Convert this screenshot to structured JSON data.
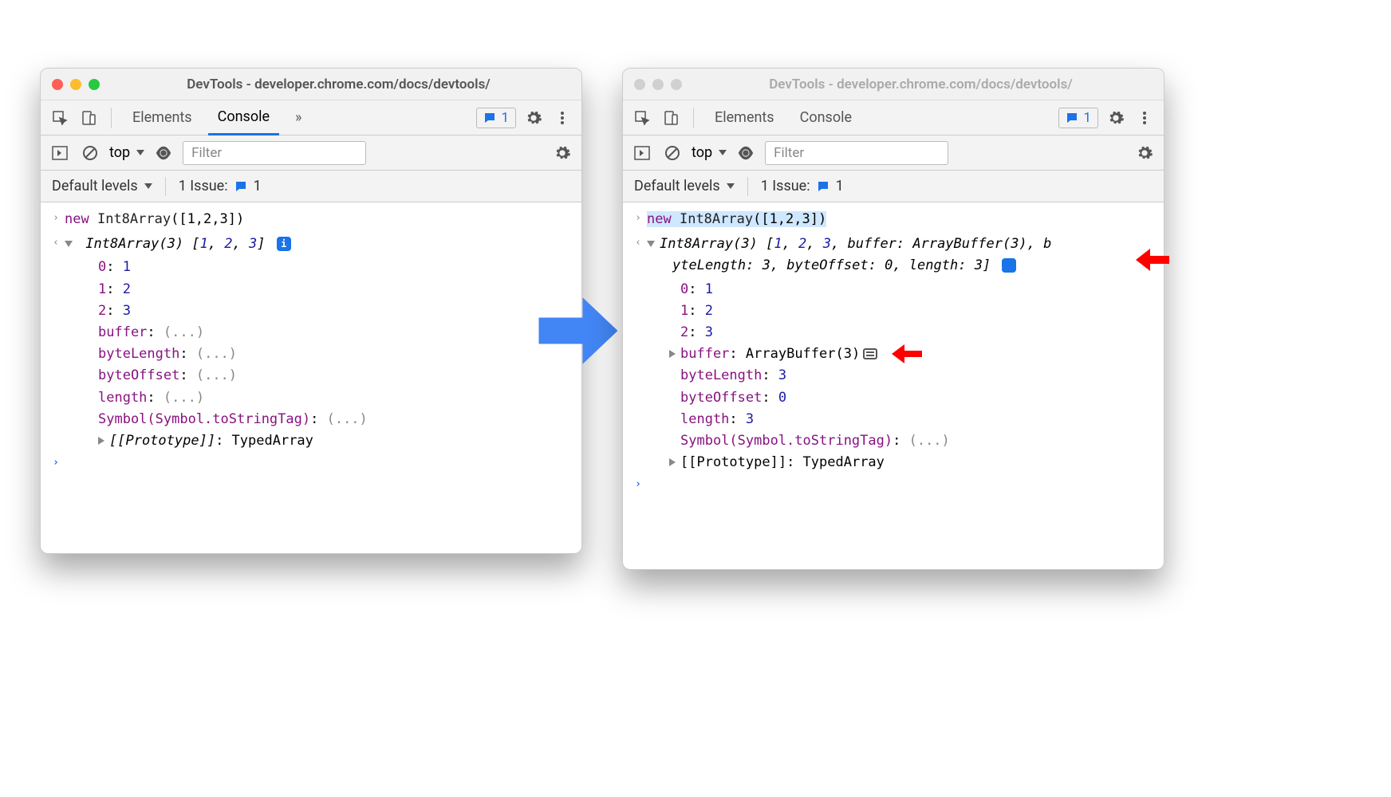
{
  "windowTitle": "DevTools - developer.chrome.com/docs/devtools/",
  "tabs": {
    "elements": "Elements",
    "console": "Console",
    "more": "»"
  },
  "messagesBadge": "1",
  "toolbar": {
    "context": "top",
    "filterPlaceholder": "Filter"
  },
  "toolbar2": {
    "levels": "Default levels",
    "issueLabel": "1 Issue:",
    "issueCount": "1"
  },
  "input": {
    "new": "new",
    "fn": "Int8Array",
    "args": "([1,2,3])"
  },
  "left": {
    "summary": {
      "type": "Int8Array(3)",
      "vals": [
        "1",
        "2",
        "3"
      ]
    },
    "props": {
      "0": "1",
      "1": "2",
      "2": "3",
      "buffer": "(...)",
      "byteLength": "(...)",
      "byteOffset": "(...)",
      "length": "(...)",
      "symbol": "Symbol(Symbol.toStringTag)",
      "symbolVal": "(...)",
      "proto": "[[Prototype]]",
      "protoVal": "TypedArray"
    }
  },
  "right": {
    "summary": {
      "type": "Int8Array(3)",
      "line1_after": ", buffer: ArrayBuffer(3), b",
      "line2": "yteLength: 3, byteOffset: 0, length: 3]"
    },
    "vals": [
      "1",
      "2",
      "3"
    ],
    "props": {
      "0": "1",
      "1": "2",
      "2": "3",
      "buffer": "buffer",
      "bufferVal": "ArrayBuffer(3)",
      "byteLength": "byteLength",
      "byteLengthVal": "3",
      "byteOffset": "byteOffset",
      "byteOffsetVal": "0",
      "length": "length",
      "lengthVal": "3",
      "symbol": "Symbol(Symbol.toStringTag)",
      "symbolVal": "(...)",
      "proto": "[[Prototype]]",
      "protoVal": "TypedArray"
    }
  }
}
